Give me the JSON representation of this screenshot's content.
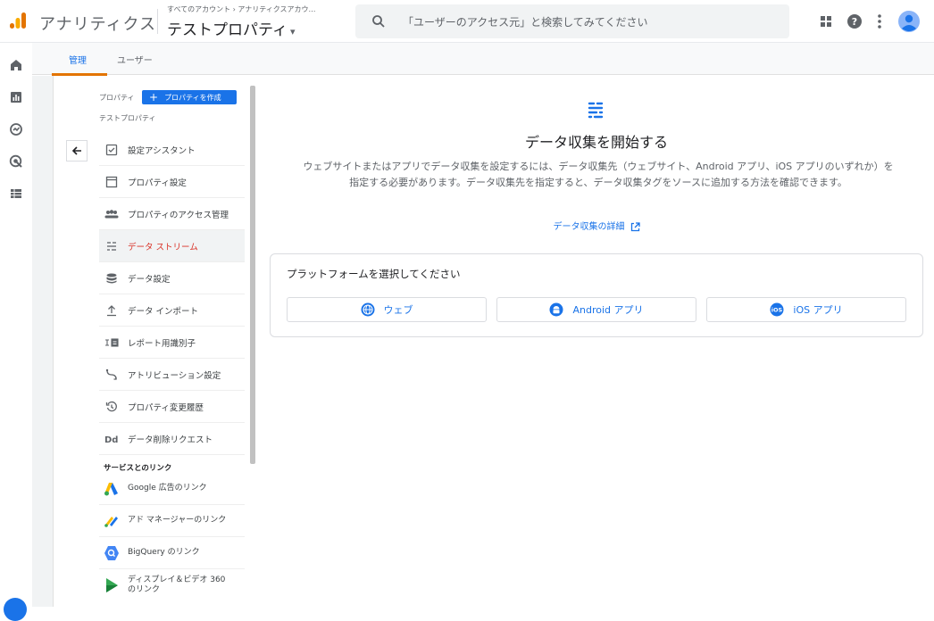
{
  "topbar": {
    "app_name": "アナリティクス",
    "breadcrumb": "すべてのアカウント › アナリティクスアカウ…",
    "property": "テストプロパティ",
    "caret": "▾",
    "search_placeholder": "「ユーザーのアクセス元」と検索してみてください",
    "icons": [
      "apps-grid-icon",
      "help-icon",
      "more-vert-icon",
      "account-avatar-icon"
    ]
  },
  "rail": {
    "icons": [
      "home-icon",
      "reports-icon",
      "explore-icon",
      "advertising-icon",
      "configure-icon"
    ]
  },
  "tabs": [
    {
      "label": "管理",
      "active": true
    },
    {
      "label": "ユーザー",
      "active": false
    }
  ],
  "admin": {
    "property_label": "プロパティ",
    "create_button": "プロパティを作成",
    "create_plus": "+",
    "property_name": "テストプロパティ",
    "items": [
      {
        "label": "設定アシスタント",
        "icon": "checklist-icon"
      },
      {
        "label": "プロパティ設定",
        "icon": "window-icon"
      },
      {
        "label": "プロパティのアクセス管理",
        "icon": "people-icon"
      },
      {
        "label": "データ ストリーム",
        "icon": "data-stream-icon",
        "active": true
      },
      {
        "label": "データ設定",
        "icon": "database-icon"
      },
      {
        "label": "データ インポート",
        "icon": "upload-icon"
      },
      {
        "label": "レポート用識別子",
        "icon": "identifier-icon"
      },
      {
        "label": "アトリビューション設定",
        "icon": "attribution-icon"
      },
      {
        "label": "プロパティ変更履歴",
        "icon": "history-icon"
      },
      {
        "label": "データ削除リクエスト",
        "icon": "delete-request-icon"
      }
    ],
    "section": "サービスとのリンク",
    "links": [
      {
        "label": "Google 広告のリンク",
        "icon": "google-ads-icon"
      },
      {
        "label": "アド マネージャーのリンク",
        "icon": "ad-manager-icon"
      },
      {
        "label": "BigQuery のリンク",
        "icon": "bigquery-icon"
      },
      {
        "label": "ディスプレイ＆ビデオ 360 のリンク",
        "icon": "display-video-icon"
      }
    ]
  },
  "content": {
    "title": "データ収集を開始する",
    "description": "ウェブサイトまたはアプリでデータ収集を設定するには、データ収集先（ウェブサイト、Android アプリ、iOS アプリのいずれか）を指定する必要があります。データ収集先を指定すると、データ収集タグをソースに追加する方法を確認できます。",
    "learn_more": "データ収集の詳細",
    "platform_title": "プラットフォームを選択してください",
    "platforms": [
      {
        "label": "ウェブ",
        "icon": "globe-icon"
      },
      {
        "label": "Android アプリ",
        "icon": "android-icon"
      },
      {
        "label": "iOS アプリ",
        "icon": "ios-icon"
      }
    ]
  },
  "colors": {
    "accent": "#1a73e8",
    "active_nav": "#d93025",
    "tab_underline": "#e37400"
  }
}
